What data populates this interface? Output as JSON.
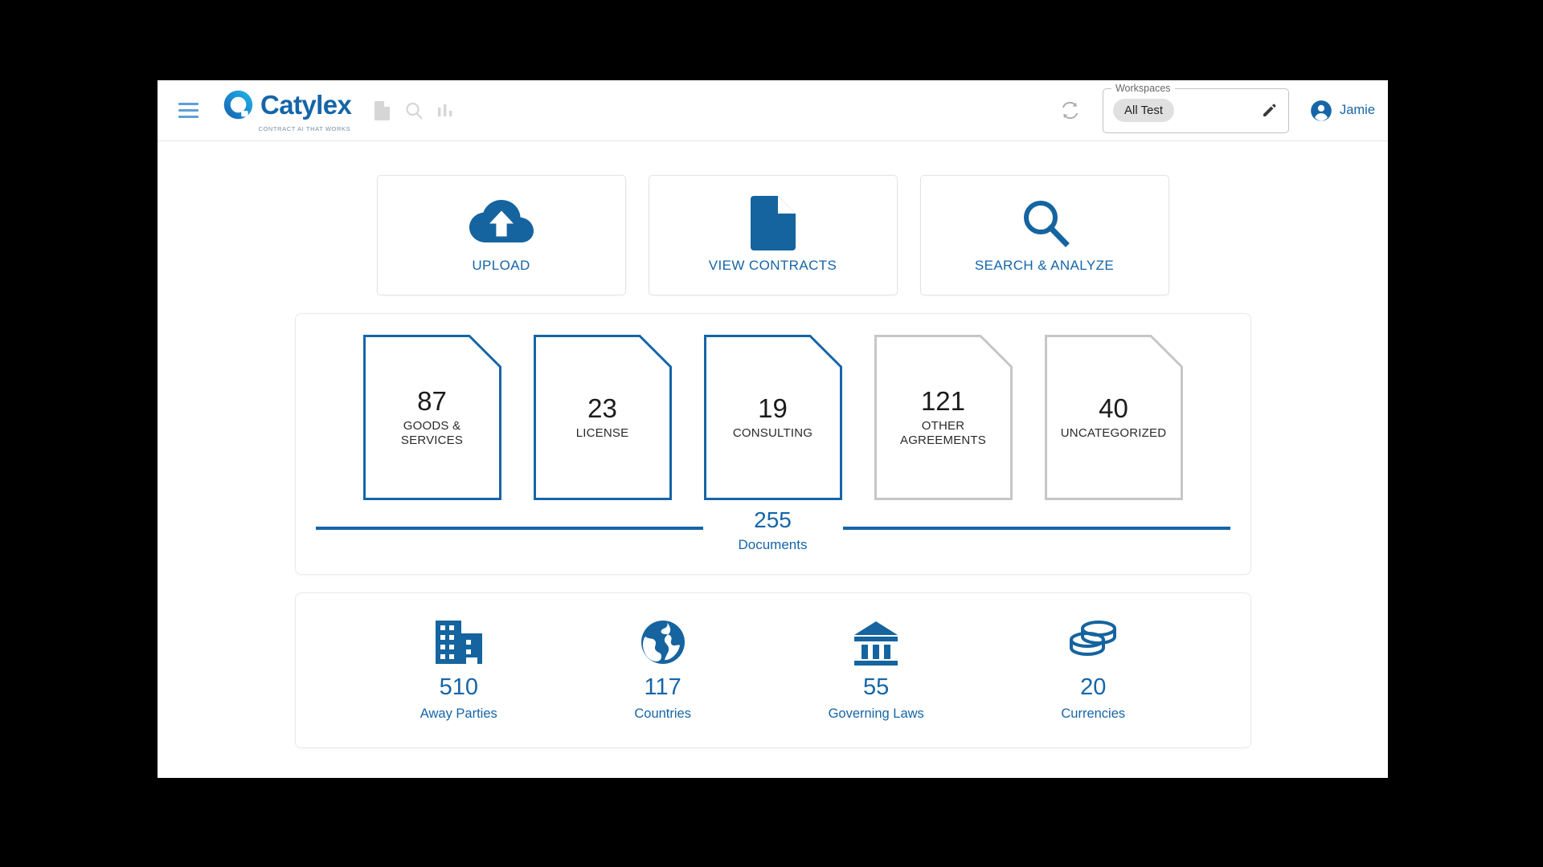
{
  "brand": {
    "name": "Catylex",
    "tagline": "CONTRACT AI THAT WORKS",
    "logo_color": "#1565a8"
  },
  "header": {
    "menu_icon": "hamburger-menu-icon",
    "tools": [
      {
        "icon": "document-icon"
      },
      {
        "icon": "search-icon"
      },
      {
        "icon": "bar-chart-icon"
      }
    ],
    "refresh_icon": "refresh-icon",
    "workspaces": {
      "legend": "Workspaces",
      "selected": "All Test",
      "edit_icon": "pencil-edit-icon"
    },
    "user": {
      "name": "Jamie",
      "avatar_icon": "account-circle-icon"
    }
  },
  "actions": [
    {
      "label": "UPLOAD",
      "icon": "cloud-upload-icon"
    },
    {
      "label": "VIEW CONTRACTS",
      "icon": "document-filled-icon"
    },
    {
      "label": "SEARCH & ANALYZE",
      "icon": "magnifier-icon"
    }
  ],
  "documents": {
    "categories": [
      {
        "count": "87",
        "label": "GOODS &\nSERVICES",
        "label_lines": [
          "GOODS &",
          "SERVICES"
        ],
        "accent": "#1565a8"
      },
      {
        "count": "23",
        "label": "LICENSE",
        "label_lines": [
          "LICENSE"
        ],
        "accent": "#1565a8"
      },
      {
        "count": "19",
        "label": "CONSULTING",
        "label_lines": [
          "CONSULTING"
        ],
        "accent": "#1565a8"
      },
      {
        "count": "121",
        "label": "OTHER AGREEMENTS",
        "label_lines": [
          "OTHER",
          "AGREEMENTS"
        ],
        "accent": "#c6c6c6"
      },
      {
        "count": "40",
        "label": "UNCATEGORIZED",
        "label_lines": [
          "UNCATEGORIZED"
        ],
        "accent": "#c6c6c6"
      }
    ],
    "total_count": "255",
    "total_label": "Documents"
  },
  "stats": [
    {
      "count": "510",
      "label": "Away Parties",
      "icon": "office-building-icon"
    },
    {
      "count": "117",
      "label": "Countries",
      "icon": "globe-icon"
    },
    {
      "count": "55",
      "label": "Governing Laws",
      "icon": "bank-columns-icon"
    },
    {
      "count": "20",
      "label": "Currencies",
      "icon": "stacked-coins-icon"
    }
  ],
  "colors": {
    "primary_blue": "#1565a8",
    "light_blue": "#5f9ed6",
    "muted_gray": "#c6c6c6"
  }
}
